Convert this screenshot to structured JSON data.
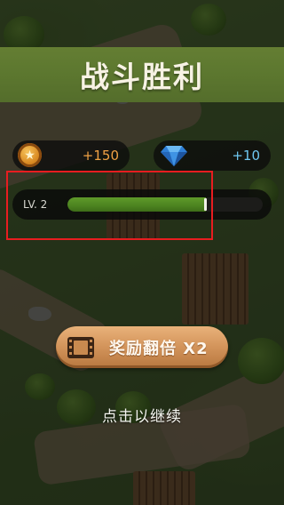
{
  "title": "战斗胜利",
  "rewards": {
    "coins": {
      "icon": "star-coin-icon",
      "value": "+150",
      "color": "#f0a144"
    },
    "gems": {
      "icon": "blue-gem-icon",
      "value": "+10",
      "color": "#6fc7f0"
    }
  },
  "level": {
    "label": "LV. 2",
    "progress": 0.71
  },
  "double_button": {
    "icon": "video-film-icon",
    "label": "奖励翻倍 X2"
  },
  "continue_text": "点击以继续",
  "colors": {
    "banner": "#5c772f",
    "xp_fill": "#4c8320",
    "button": "#d2935a",
    "highlight": "#e81d20"
  }
}
